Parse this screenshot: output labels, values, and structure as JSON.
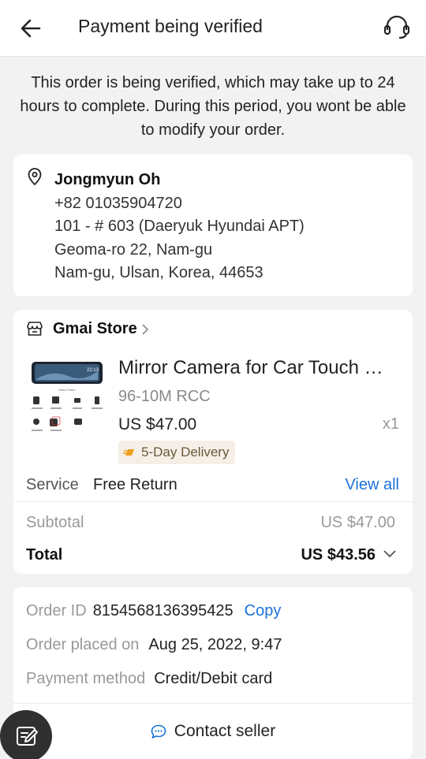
{
  "header": {
    "title": "Payment being verified",
    "back_icon": "arrow-left-icon",
    "support_icon": "headset-icon"
  },
  "notice": "This order is being verified, which may take up to 24 hours to complete. During this period, you wont be able to modify your order.",
  "address": {
    "name": "Jongmyun Oh",
    "phone": "+82 01035904720",
    "line1": "101 - # 603 (Daeryuk Hyundai APT)",
    "line2": "Geoma-ro 22, Nam-gu",
    "line3": "Nam-gu, Ulsan, Korea, 44653"
  },
  "store": {
    "name": "Gmai Store"
  },
  "product": {
    "title": "Mirror Camera for Car Touch …",
    "variant": "96-10M  RCC",
    "price": "US $47.00",
    "quantity": "x1",
    "delivery": "5-Day Delivery",
    "thumb_time": "22:13",
    "thumb_caption": "Mirror Dash"
  },
  "service": {
    "label": "Service",
    "value": "Free Return",
    "link": "View all"
  },
  "summary": {
    "subtotal_label": "Subtotal",
    "subtotal_value": "US $47.00",
    "total_label": "Total",
    "total_value": "US $43.56"
  },
  "order_info": {
    "id_label": "Order ID",
    "id_value": "8154568136395425",
    "copy_label": "Copy",
    "placed_label": "Order placed on",
    "placed_value": "Aug 25, 2022, 9:47",
    "payment_label": "Payment method",
    "payment_value": "Credit/Debit card",
    "contact_label": "Contact seller"
  },
  "colors": {
    "link": "#1a73d9",
    "fab": "#303030",
    "delivery_bg": "#f5efe7",
    "delivery_icon": "#f0a020"
  }
}
